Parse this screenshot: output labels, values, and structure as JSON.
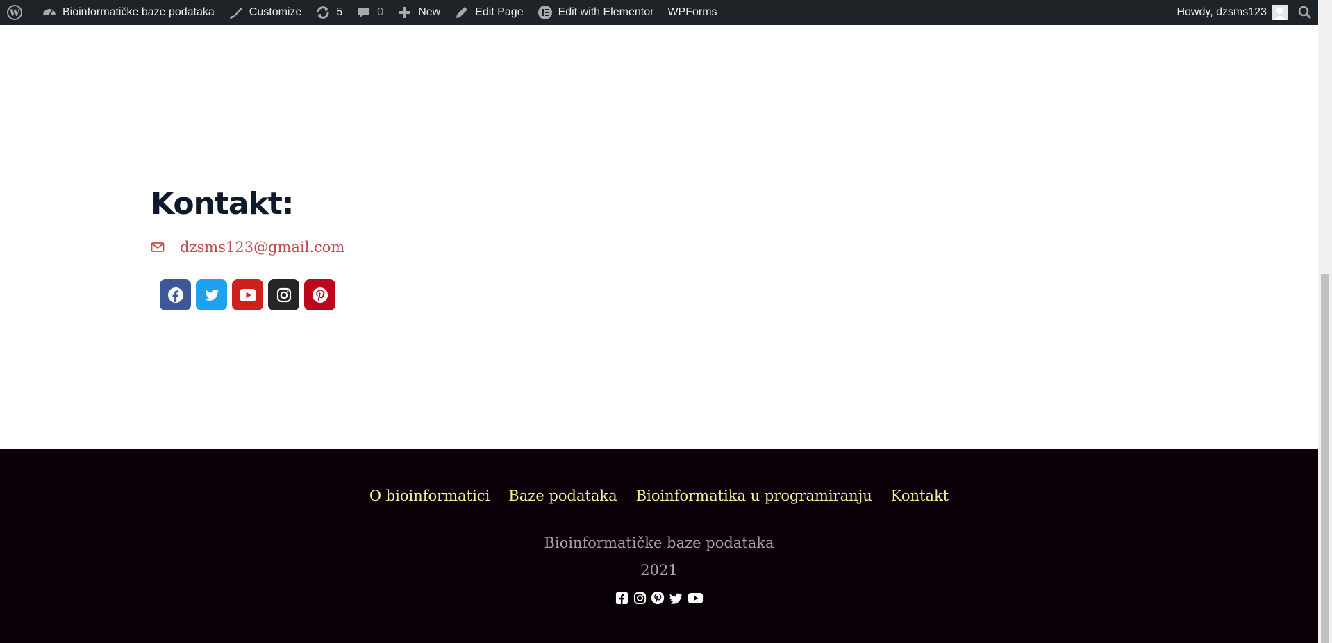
{
  "admin_bar": {
    "wp_logo_icon": "wordpress-icon",
    "site_name": "Bioinformatičke baze podataka",
    "customize": "Customize",
    "updates_count": "5",
    "comments_count": "0",
    "new": "New",
    "edit_page": "Edit Page",
    "edit_elementor": "Edit with Elementor",
    "wpforms": "WPForms",
    "howdy": "Howdy, dzsms123"
  },
  "contact": {
    "title": "Kontakt:",
    "email": "dzsms123@gmail.com",
    "social": [
      {
        "name": "facebook",
        "color": "#3b5998"
      },
      {
        "name": "twitter",
        "color": "#1da1f2"
      },
      {
        "name": "youtube",
        "color": "#cd201f"
      },
      {
        "name": "instagram",
        "color": "#262626"
      },
      {
        "name": "pinterest",
        "color": "#bd081c"
      }
    ]
  },
  "footer": {
    "nav": [
      "O bioinformatici",
      "Baze podataka",
      "Bioinformatika u programiranju",
      "Kontakt"
    ],
    "site_name": "Bioinformatičke baze podataka",
    "year": "2021",
    "icons": [
      "facebook-square-icon",
      "instagram-icon",
      "pinterest-icon",
      "twitter-icon",
      "youtube-icon"
    ]
  },
  "colors": {
    "admin_bg": "#1d2327",
    "footer_bg": "#0b0008",
    "footer_link": "#f3ec9a",
    "email_link": "#c0504d"
  }
}
